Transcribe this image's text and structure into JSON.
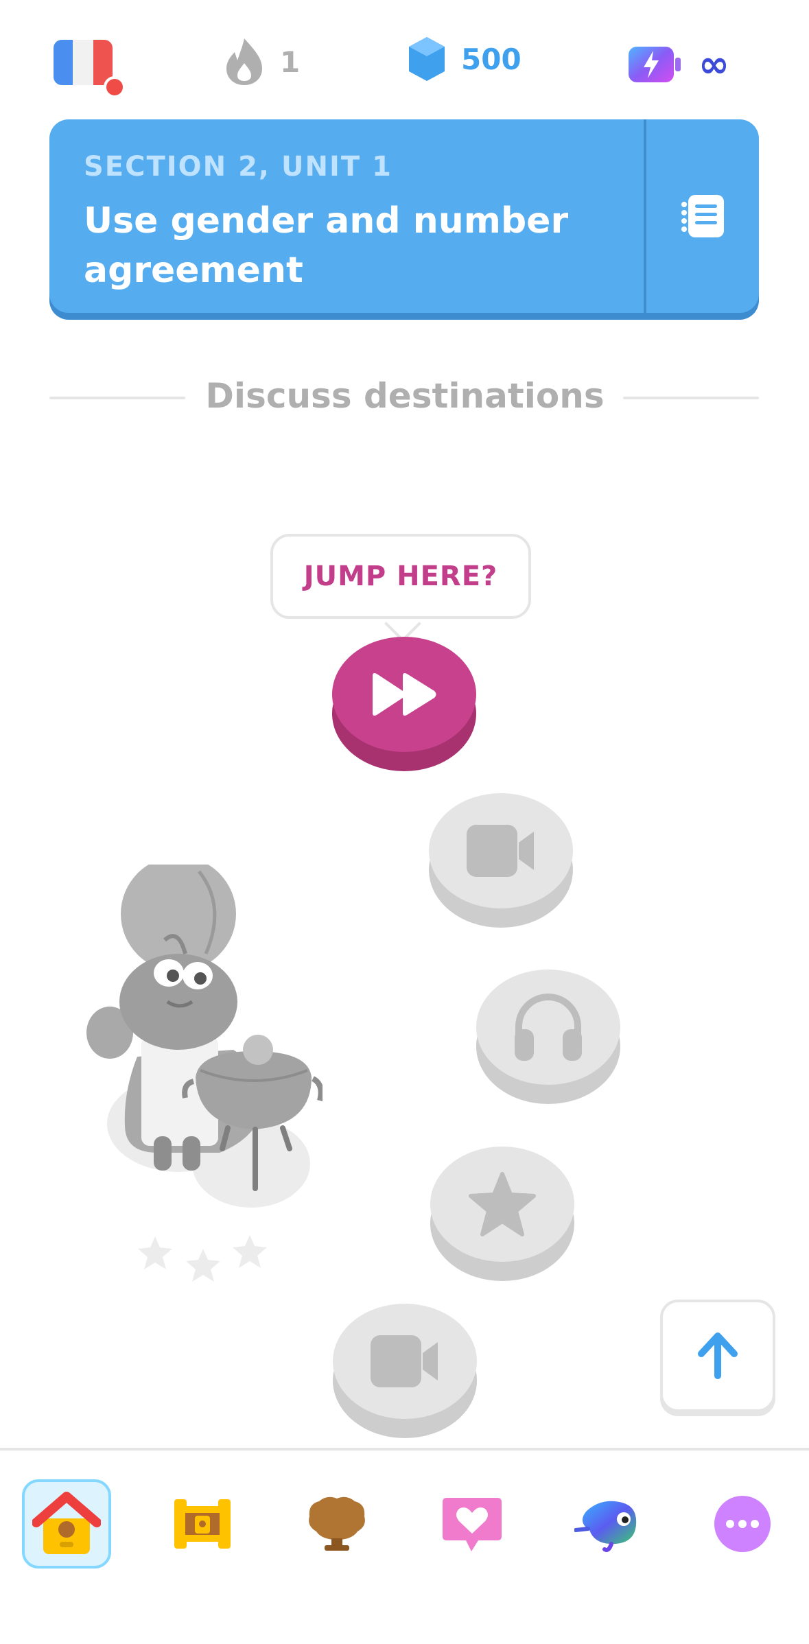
{
  "top_bar": {
    "language": "French",
    "streak_count": "1",
    "gems_count": "500",
    "energy_value": "∞"
  },
  "unit_banner": {
    "section_label": "SECTION 2, UNIT 1",
    "title": "Use gender and number agreement"
  },
  "section_divider": {
    "label": "Discuss destinations"
  },
  "path": {
    "jump_prompt": "JUMP HERE?",
    "nodes": [
      "jump",
      "video",
      "audio",
      "star",
      "video"
    ],
    "character_stars": 3
  },
  "bottom_nav": {
    "items": [
      "learn",
      "practice",
      "leaderboards",
      "friends",
      "profile",
      "more"
    ],
    "active": "learn"
  },
  "colors": {
    "banner": "#55acef",
    "jump": "#c8418d",
    "locked": "#e5e5e5"
  }
}
